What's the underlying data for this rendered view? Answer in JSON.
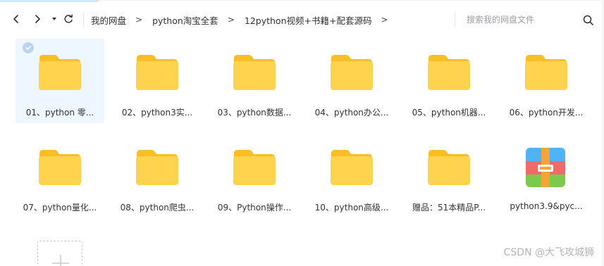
{
  "toolbar": {
    "back_icon": "chevron-left-icon",
    "forward_icon": "chevron-right-icon",
    "history_icon": "caret-down-icon",
    "refresh_icon": "refresh-icon",
    "breadcrumb_separator": ">",
    "breadcrumbs": [
      {
        "label": "我的网盘"
      },
      {
        "label": "python淘宝全套"
      },
      {
        "label": "12python视频+书籍+配套源码"
      }
    ],
    "search_placeholder": "搜索我的网盘文件",
    "search_icon": "search-icon"
  },
  "files": [
    {
      "label": "01、python 零...",
      "type": "folder",
      "selected": true
    },
    {
      "label": "02、python3实...",
      "type": "folder"
    },
    {
      "label": "03、python数据...",
      "type": "folder"
    },
    {
      "label": "04、python办公...",
      "type": "folder"
    },
    {
      "label": "05、python机器...",
      "type": "folder"
    },
    {
      "label": "06、python开发...",
      "type": "folder"
    },
    {
      "label": "07、python量化...",
      "type": "folder"
    },
    {
      "label": "08、python爬虫...",
      "type": "folder"
    },
    {
      "label": "09、Python操作...",
      "type": "folder"
    },
    {
      "label": "10、python高级...",
      "type": "folder"
    },
    {
      "label": "赠品：51本精品P...",
      "type": "folder"
    },
    {
      "label": "python3.9&pyc...",
      "type": "archive"
    }
  ],
  "new_item_icon": "plus-icon",
  "watermark": "CSDN @大飞攻城狮",
  "colors": {
    "folder": "#ffd34e",
    "folder_tab": "#f9be26",
    "selected_bg": "#eef6ff",
    "check": "#b8d4ef",
    "archive_blue": "#4fb3f5",
    "archive_orange": "#f4a538",
    "archive_red": "#f06a6a",
    "archive_green": "#7cc94d"
  }
}
